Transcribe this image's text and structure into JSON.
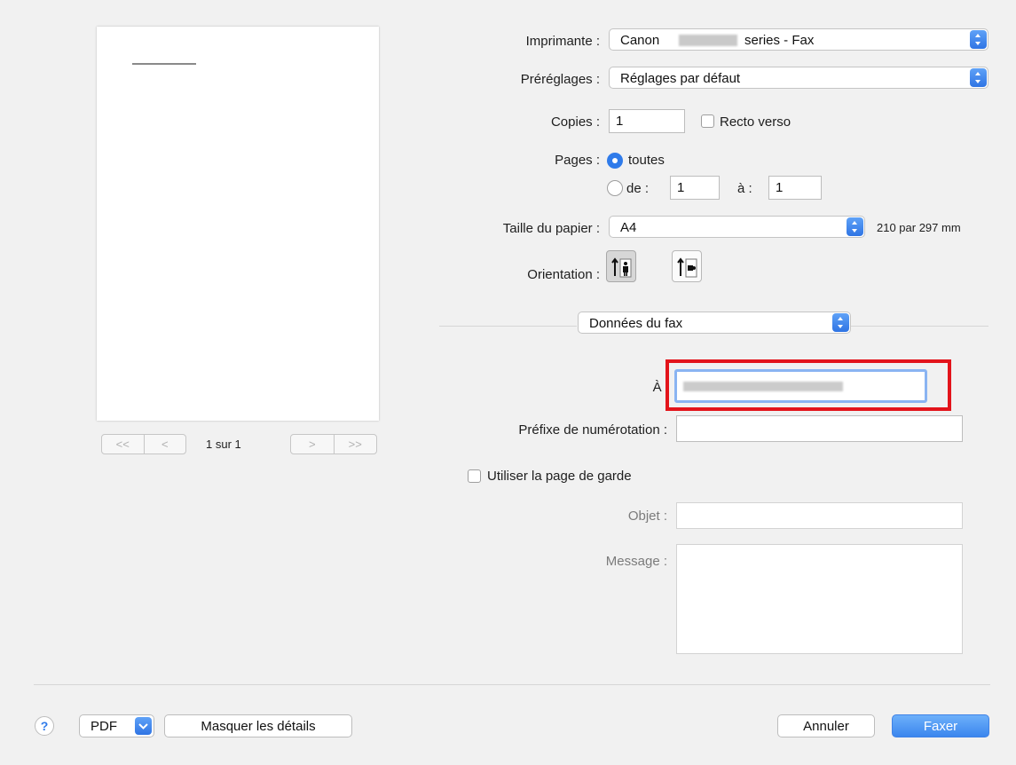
{
  "preview": {
    "page_indicator": "1 sur 1",
    "nav_first": "<<",
    "nav_prev": "<",
    "nav_next": ">",
    "nav_last": ">>"
  },
  "printer": {
    "label": "Imprimante :",
    "value_prefix": "Canon",
    "value_suffix": "series - Fax"
  },
  "presets": {
    "label": "Préréglages :",
    "value": "Réglages par défaut"
  },
  "copies": {
    "label": "Copies :",
    "value": "1",
    "duplex_label": "Recto verso"
  },
  "pages": {
    "label": "Pages :",
    "all_label": "toutes",
    "range_label": "de :",
    "from": "1",
    "to_label": "à :",
    "to": "1"
  },
  "paper": {
    "label": "Taille du papier :",
    "value": "A4",
    "dimensions": "210 par 297 mm"
  },
  "orientation": {
    "label": "Orientation :"
  },
  "section": {
    "value": "Données du fax"
  },
  "fax": {
    "to_label": "À :",
    "prefix_label": "Préfixe de numérotation :",
    "cover_label": "Utiliser la page de garde",
    "subject_label": "Objet :",
    "message_label": "Message :"
  },
  "footer": {
    "help": "?",
    "pdf": "PDF",
    "hide_details": "Masquer les détails",
    "cancel": "Annuler",
    "submit": "Faxer"
  },
  "colors": {
    "accent": "#2f7bea",
    "highlight": "#e3141b"
  }
}
